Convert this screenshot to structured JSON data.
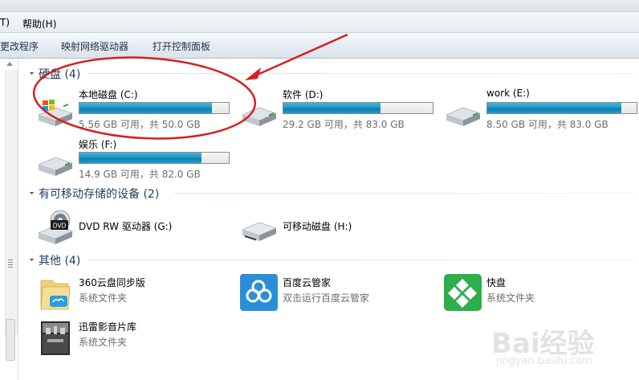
{
  "menubar": {
    "items": [
      {
        "label": "T)"
      },
      {
        "label": "帮助(H)"
      }
    ]
  },
  "toolbar": {
    "items": [
      {
        "label": "更改程序"
      },
      {
        "label": "映射网络驱动器"
      },
      {
        "label": "打开控制面板"
      }
    ]
  },
  "groups": {
    "hard_disks": {
      "title": "硬盘 (4)"
    },
    "removable": {
      "title": "有可移动存储的设备 (2)"
    },
    "other": {
      "title": "其他 (4)"
    }
  },
  "drives": [
    {
      "name": "本地磁盘 (C:)",
      "info": "5.56 GB 可用，共 50.0 GB",
      "used_fraction": 0.889
    },
    {
      "name": "软件 (D:)",
      "info": "29.2 GB 可用，共 83.0 GB",
      "used_fraction": 0.648
    },
    {
      "name": "work (E:)",
      "info": "8.50 GB 可用，共 83.0 GB",
      "used_fraction": 0.898
    },
    {
      "name": "娱乐 (F:)",
      "info": "14.9 GB 可用，共 82.0 GB",
      "used_fraction": 0.818
    }
  ],
  "removable_devices": [
    {
      "name": "DVD RW 驱动器 (G:)",
      "icon": "dvd-drive-icon"
    },
    {
      "name": "可移动磁盘 (H:)",
      "icon": "removable-disk-icon"
    }
  ],
  "other_items": [
    {
      "name": "360云盘同步版",
      "sub": "系统文件夹",
      "icon": "360-cloud-icon"
    },
    {
      "name": "百度云管家",
      "sub": "双击运行百度云管家",
      "icon": "baidu-cloud-icon"
    },
    {
      "name": "快盘",
      "sub": "系统文件夹",
      "icon": "kuaipan-icon"
    },
    {
      "name": "迅雷影音片库",
      "sub": "系统文件夹",
      "icon": "xunlei-icon"
    }
  ],
  "watermark": {
    "big": "Bai经验",
    "small": "jingyan.baidu.com"
  },
  "colors": {
    "usage_bar": "#1a9bcb",
    "annotation_red": "#d62020",
    "group_title": "#1f3c5a"
  }
}
